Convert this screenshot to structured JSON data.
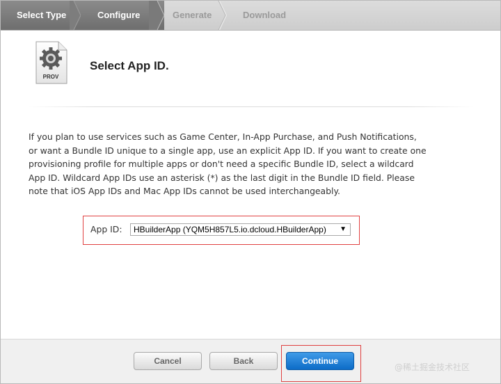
{
  "steps": [
    {
      "label": "Select Type",
      "state": "done"
    },
    {
      "label": "Configure",
      "state": "active"
    },
    {
      "label": "Generate",
      "state": "pending"
    },
    {
      "label": "Download",
      "state": "pending"
    }
  ],
  "header": {
    "icon_label": "PROV",
    "title": "Select App ID."
  },
  "description": [
    "If you plan to use services such as Game Center, In-App Purchase, and Push Notifications,",
    "or want a Bundle ID unique to a single app, use an explicit App ID. If you want to create one",
    "provisioning profile for multiple apps or don't need a specific Bundle ID, select a wildcard",
    "App ID. Wildcard App IDs use an asterisk (*) as the last digit in the Bundle ID field. Please",
    "note that iOS App IDs and Mac App IDs cannot be used interchangeably."
  ],
  "app_id": {
    "label": "App ID:",
    "selected": "HBuilderApp (YQM5H857L5.io.dcloud.HBuilderApp)"
  },
  "buttons": {
    "cancel": "Cancel",
    "back": "Back",
    "continue": "Continue"
  },
  "watermark": "@稀土掘金技术社区",
  "colors": {
    "accent_blue": "#1a7fd8",
    "highlight_red": "#e04040",
    "step_active": "#6e6e6e"
  }
}
